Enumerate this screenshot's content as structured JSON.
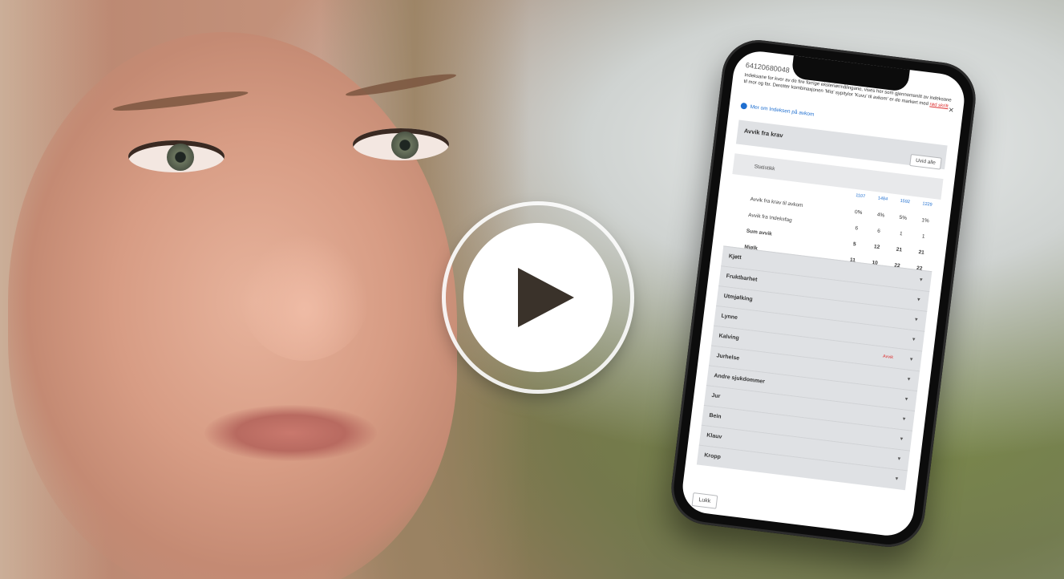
{
  "phone": {
    "app_id": "64120680048",
    "close_label": "×",
    "intro_text": "Indeksane for kver av de fire forrige eksteriørmålingane, vises her som gjennomsnitt av indeksane til mor og far. Deretter kombinasjonen 'Mia' sypitylor 'Kuvu' til avkom' er de markert med",
    "intro_red": "rød skrift",
    "info_link": "Mer om Indeksen på avkom",
    "section_title": "Avvik fra krav",
    "hide_all_button": "Uvid alle",
    "stat_title": "Statistikk",
    "table": {
      "headers": [
        "1107",
        "1484",
        "1592",
        "1229"
      ],
      "rows": [
        {
          "label": "Avvik fra krav til avkom",
          "values": [
            "0%",
            "4%",
            "5%",
            "1%"
          ]
        },
        {
          "label": "Avvik fra Indeksfag",
          "values": [
            "6",
            "6",
            "1",
            "1"
          ]
        },
        {
          "label": "Sum avvik",
          "values": [
            "5",
            "12",
            "21",
            "21"
          ]
        },
        {
          "label": "Mjølk",
          "values": [
            "11",
            "10",
            "22",
            "22"
          ]
        }
      ]
    },
    "categories": [
      {
        "label": "Kjøtt",
        "flag": ""
      },
      {
        "label": "Fruktbarhet",
        "flag": ""
      },
      {
        "label": "Utmjølking",
        "flag": ""
      },
      {
        "label": "Lynne",
        "flag": ""
      },
      {
        "label": "Kalving",
        "flag": "Avvik"
      },
      {
        "label": "Jurhelse",
        "flag": ""
      },
      {
        "label": "Andre sjukdommer",
        "flag": ""
      },
      {
        "label": "Jur",
        "flag": ""
      },
      {
        "label": "Bein",
        "flag": ""
      },
      {
        "label": "Klauv",
        "flag": ""
      },
      {
        "label": "Kropp",
        "flag": ""
      }
    ],
    "footer_button": "Lukk"
  },
  "play_button": {
    "icon": "play-icon"
  },
  "colors": {
    "link": "#1f6fd0",
    "alert": "#dd3333",
    "panel": "#dfe1e4"
  }
}
